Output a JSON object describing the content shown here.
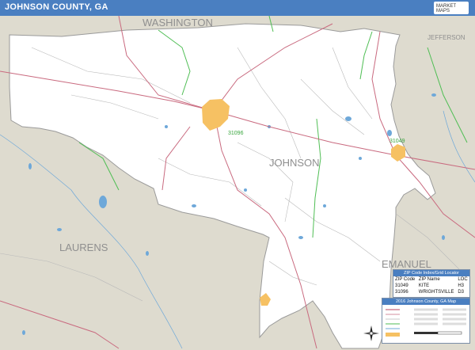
{
  "header": {
    "title": "JOHNSON COUNTY, GA",
    "logo_text": "MARKET MAPS"
  },
  "map": {
    "county_label": "JOHNSON",
    "neighbor_labels": {
      "washington": "WASHINGTON",
      "jefferson": "JEFFERSON",
      "laurens": "LAURENS",
      "emanuel": "EMANUEL"
    },
    "zip_labels": {
      "z31096": "31096",
      "z31049": "31049"
    },
    "colors": {
      "county_fill": "#ffffff",
      "outside_fill": "#dedbcf",
      "urban": "#f6c163",
      "water": "#6ea8d9",
      "road_major": "#c96a7f",
      "road_minor": "#b9b9b9",
      "zip_boundary": "#4fbe54"
    }
  },
  "zip_legend": {
    "title": "ZIP Code Index/Grid Locator",
    "headers": [
      "ZIP Code",
      "ZIP Name",
      "LOC"
    ],
    "rows": [
      [
        "31049",
        "KITE",
        "H3"
      ],
      [
        "31096",
        "WRIGHTSVILLE",
        "D3"
      ]
    ]
  },
  "map_legend": {
    "title": "2016 Johnson County, GA Map"
  }
}
